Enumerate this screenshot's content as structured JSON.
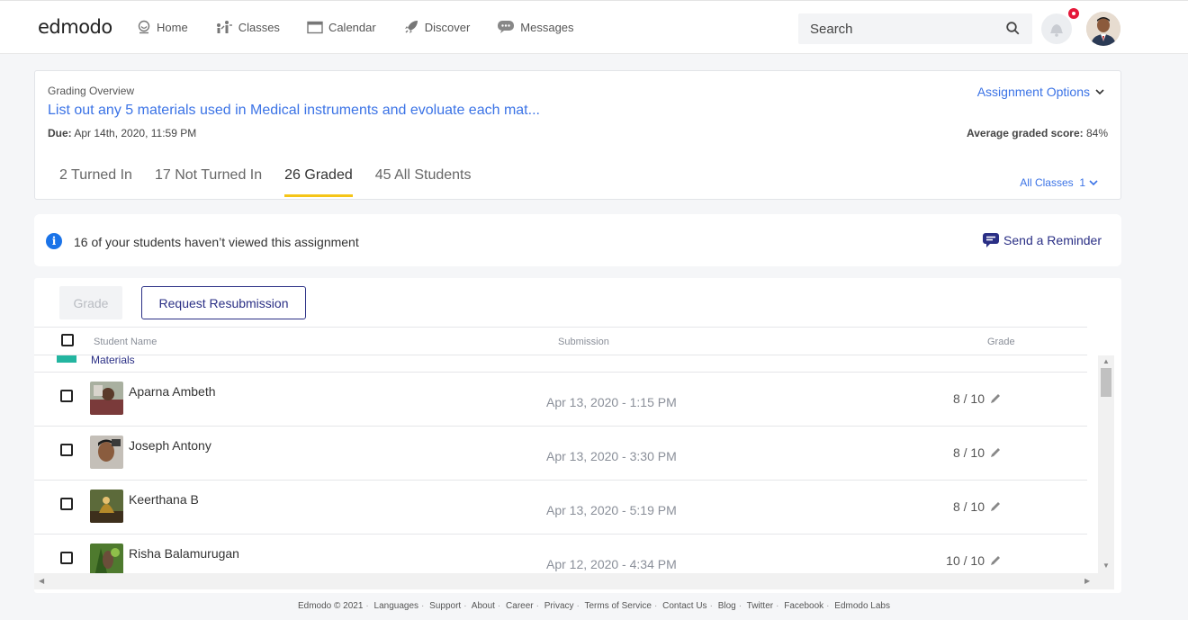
{
  "header": {
    "logo": "edmodo",
    "nav": [
      {
        "label": "Home",
        "icon": "home-icon"
      },
      {
        "label": "Classes",
        "icon": "classes-icon"
      },
      {
        "label": "Calendar",
        "icon": "calendar-icon"
      },
      {
        "label": "Discover",
        "icon": "rocket-icon"
      },
      {
        "label": "Messages",
        "icon": "messages-icon"
      }
    ],
    "search_placeholder": "Search"
  },
  "overview": {
    "label": "Grading Overview",
    "title": "List out any 5 materials used in Medical instruments and evoluate each mat...",
    "due_label": "Due:",
    "due_value": "Apr 14th, 2020, 11:59 PM",
    "options_label": "Assignment Options",
    "avg_label": "Average graded score:",
    "avg_value": "84%",
    "tabs": [
      {
        "label": "2 Turned In"
      },
      {
        "label": "17 Not Turned In"
      },
      {
        "label": "26 Graded"
      },
      {
        "label": "45 All Students"
      }
    ],
    "active_tab": "26 Graded",
    "all_classes_label": "All Classes",
    "all_classes_count": "1"
  },
  "banner": {
    "text": "16 of your students haven’t viewed this assignment",
    "reminder_label": "Send a Reminder"
  },
  "table": {
    "grade_button": "Grade",
    "resubmit_button": "Request Resubmission",
    "columns": {
      "student": "Student Name",
      "submission": "Submission",
      "grade": "Grade"
    },
    "partial_row_text": "Materials",
    "rows": [
      {
        "name": "Aparna Ambeth",
        "submission": "Apr 13, 2020 - 1:15 PM",
        "grade": "8 / 10"
      },
      {
        "name": "Joseph Antony",
        "submission": "Apr 13, 2020 - 3:30 PM",
        "grade": "8 / 10"
      },
      {
        "name": "Keerthana B",
        "submission": "Apr 13, 2020 - 5:19 PM",
        "grade": "8 / 10"
      },
      {
        "name": "Risha Balamurugan",
        "submission": "Apr 12, 2020 - 4:34 PM",
        "grade": "10 / 10"
      }
    ]
  },
  "footer": {
    "copyright": "Edmodo © 2021",
    "links": [
      "Languages",
      "Support",
      "About",
      "Career",
      "Privacy",
      "Terms of Service",
      "Contact Us",
      "Blog",
      "Twitter",
      "Facebook",
      "Edmodo Labs"
    ]
  },
  "colors": {
    "accent": "#3b73e6",
    "tab_underline": "#f5c518",
    "navy": "#2a2f85",
    "badge": "#e5183a"
  }
}
